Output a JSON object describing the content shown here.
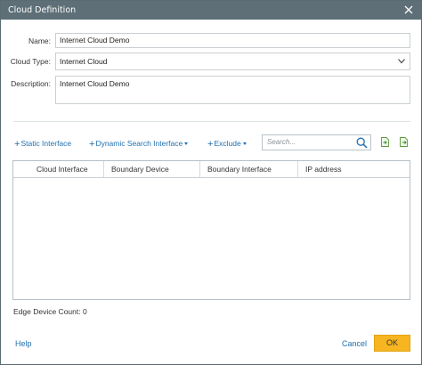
{
  "dialog": {
    "title": "Cloud Definition"
  },
  "form": {
    "name_label": "Name:",
    "name_value": "Internet Cloud Demo",
    "cloud_type_label": "Cloud Type:",
    "cloud_type_value": "Internet Cloud",
    "description_label": "Description:",
    "description_value": "Internet Cloud Demo"
  },
  "toolbar": {
    "static_interface": "Static Interface",
    "dynamic_search_interface": "Dynamic Search Interface",
    "exclude": "Exclude",
    "search_placeholder": "Search..."
  },
  "grid": {
    "columns": [
      "Cloud Interface",
      "Boundary Device",
      "Boundary Interface",
      "IP address"
    ],
    "rows": []
  },
  "footer": {
    "edge_device_count": "Edge Device Count: 0",
    "help": "Help",
    "cancel": "Cancel",
    "ok": "OK"
  },
  "colors": {
    "titlebar": "#5e6f77",
    "link": "#1f6fae",
    "ok_button": "#f6b521"
  }
}
